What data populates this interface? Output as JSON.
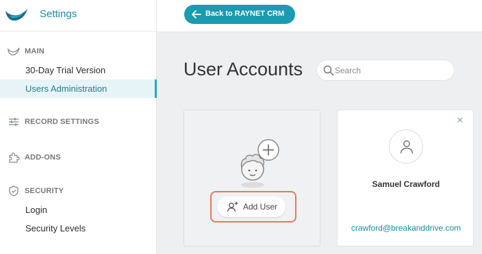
{
  "app": {
    "title": "Settings"
  },
  "topbar": {
    "back_label": "Back to RAYNET CRM"
  },
  "sidebar": {
    "sections": [
      {
        "label": "MAIN",
        "icon": "raynet-logo-icon"
      },
      {
        "label": "RECORD SETTINGS",
        "icon": "sliders-icon"
      },
      {
        "label": "ADD-ONS",
        "icon": "puzzle-icon"
      },
      {
        "label": "SECURITY",
        "icon": "shield-icon"
      }
    ],
    "items": [
      {
        "label": "30-Day Trial Version"
      },
      {
        "label": "Users Administration",
        "active": true
      },
      {
        "label": "Login"
      },
      {
        "label": "Security Levels"
      }
    ]
  },
  "main": {
    "title": "User Accounts",
    "search": {
      "placeholder": "Search",
      "value": ""
    },
    "add_user": {
      "label": "Add User"
    },
    "users": [
      {
        "name": "Samuel Crawford",
        "email": "crawford@breakanddrive.com"
      }
    ]
  },
  "colors": {
    "accent": "#1a9bb0",
    "highlight": "#e27a5e",
    "active_bg": "#e6f4f7"
  }
}
